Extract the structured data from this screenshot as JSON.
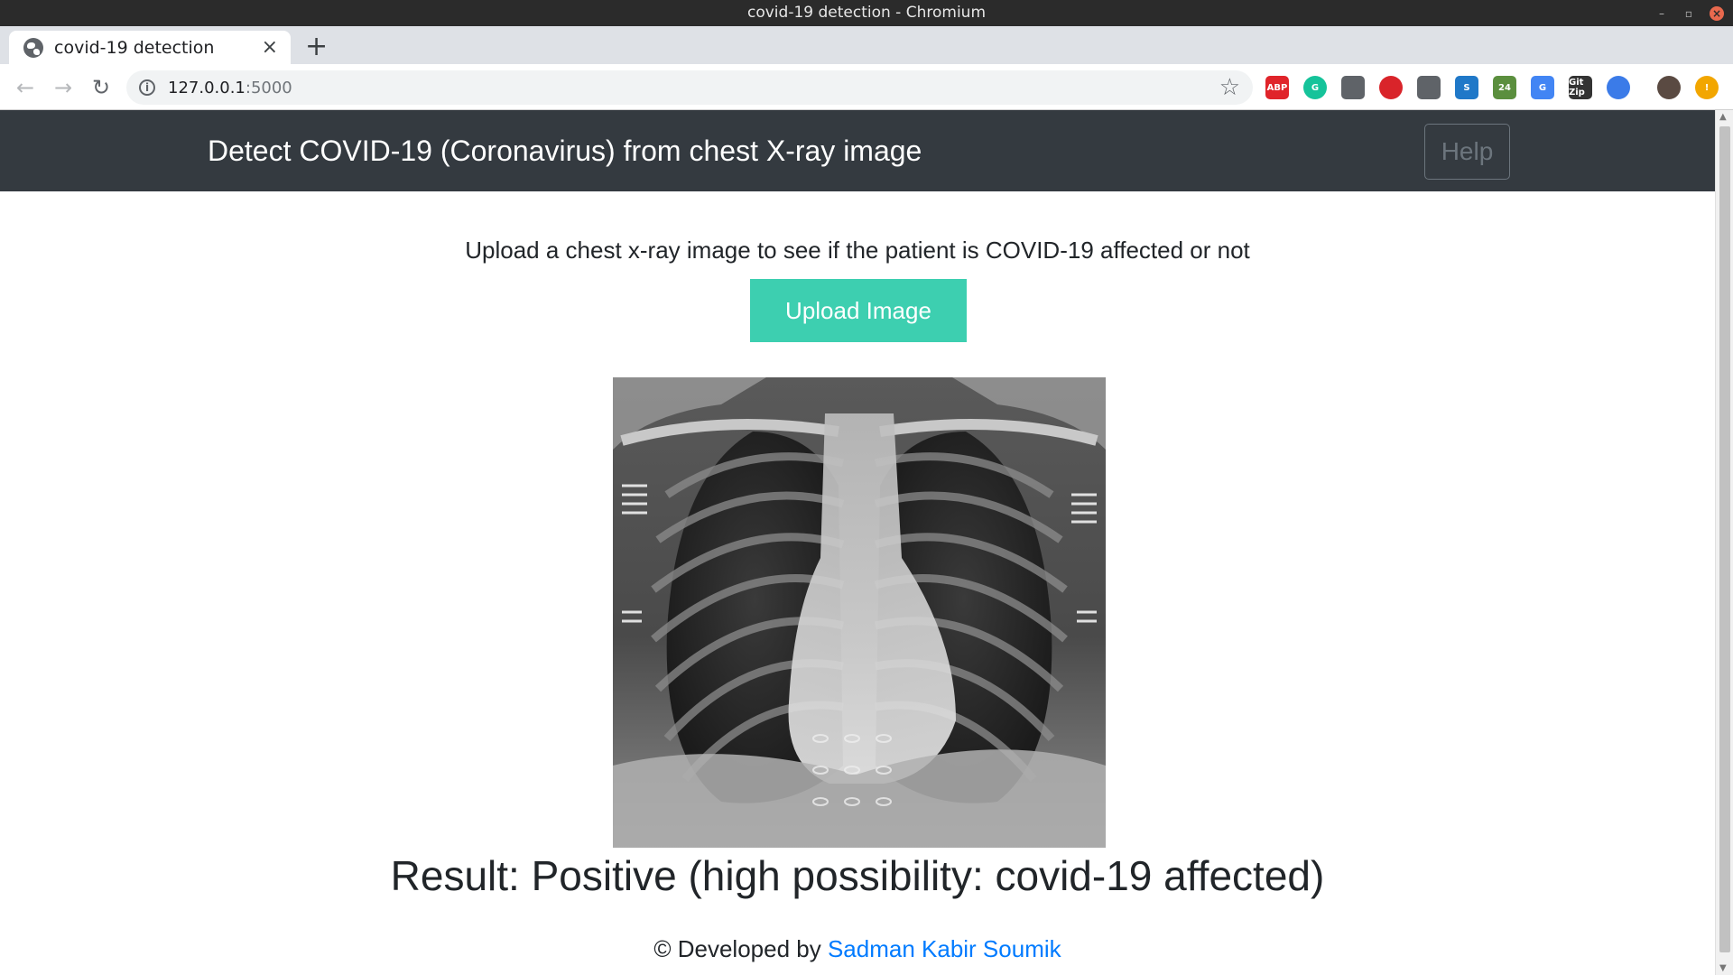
{
  "window": {
    "title": "covid-19 detection - Chromium"
  },
  "browser": {
    "tab_title": "covid-19 detection",
    "url_host": "127.0.0.1",
    "url_port": ":5000",
    "extensions": [
      {
        "name": "adblock-plus-icon",
        "label": "ABP",
        "color": "#e0242a"
      },
      {
        "name": "grammarly-icon",
        "label": "G",
        "color": "#15c39a"
      },
      {
        "name": "keeper-icon",
        "label": "",
        "color": "#5f6368"
      },
      {
        "name": "stop-icon",
        "label": "",
        "color": "#d9242a"
      },
      {
        "name": "eyedropper-icon",
        "label": "",
        "color": "#5f6368"
      },
      {
        "name": "screen-capture-icon",
        "label": "S",
        "color": "#1f78c8"
      },
      {
        "name": "calendar-icon",
        "label": "24",
        "color": "#5b8f3e"
      },
      {
        "name": "google-translate-icon",
        "label": "G",
        "color": "#4285f4"
      },
      {
        "name": "gitzip-icon",
        "label": "Git Zip",
        "color": "#333333"
      },
      {
        "name": "globe-extension-icon",
        "label": "",
        "color": "#3b7be8"
      },
      {
        "name": "profile-avatar-icon",
        "label": "",
        "color": "#5a4a42"
      },
      {
        "name": "update-alert-icon",
        "label": "!",
        "color": "#f2a600"
      }
    ]
  },
  "app": {
    "brand": "Detect COVID-19 (Coronavirus) from chest X-ray image",
    "help_label": "Help",
    "instruction": "Upload a chest x-ray image to see if the patient is COVID-19 affected or not",
    "upload_label": "Upload Image",
    "result": "Result: Positive (high possibility: covid-19 affected)",
    "footer_prefix": "© Developed by ",
    "footer_author": "Sadman Kabir Soumik"
  }
}
